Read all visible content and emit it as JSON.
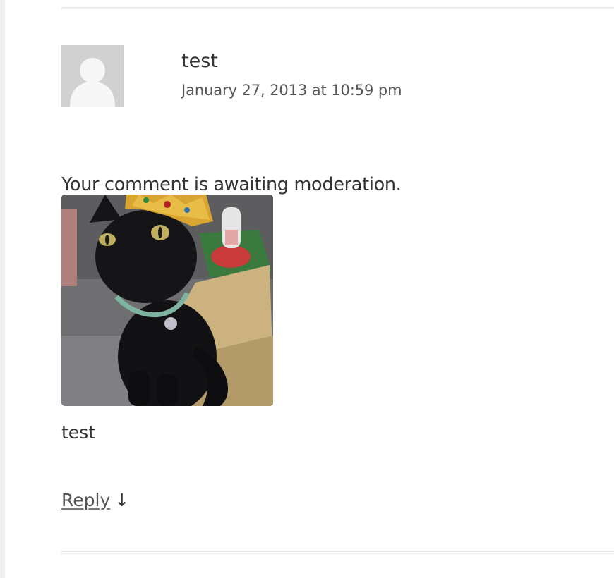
{
  "comment": {
    "author": "test",
    "date": "January 27, 2013 at 10:59 pm",
    "moderation_notice": "Your comment is awaiting moderation.",
    "text": "test",
    "reply_label": "Reply",
    "reply_arrow": "↓"
  },
  "icons": {
    "avatar": "default-avatar-icon",
    "reply_arrow": "arrow-down-icon"
  },
  "colors": {
    "text": "#333333",
    "meta_text": "#555555",
    "avatar_bg": "#d1d1d1",
    "divider": "#e6e6e6"
  }
}
